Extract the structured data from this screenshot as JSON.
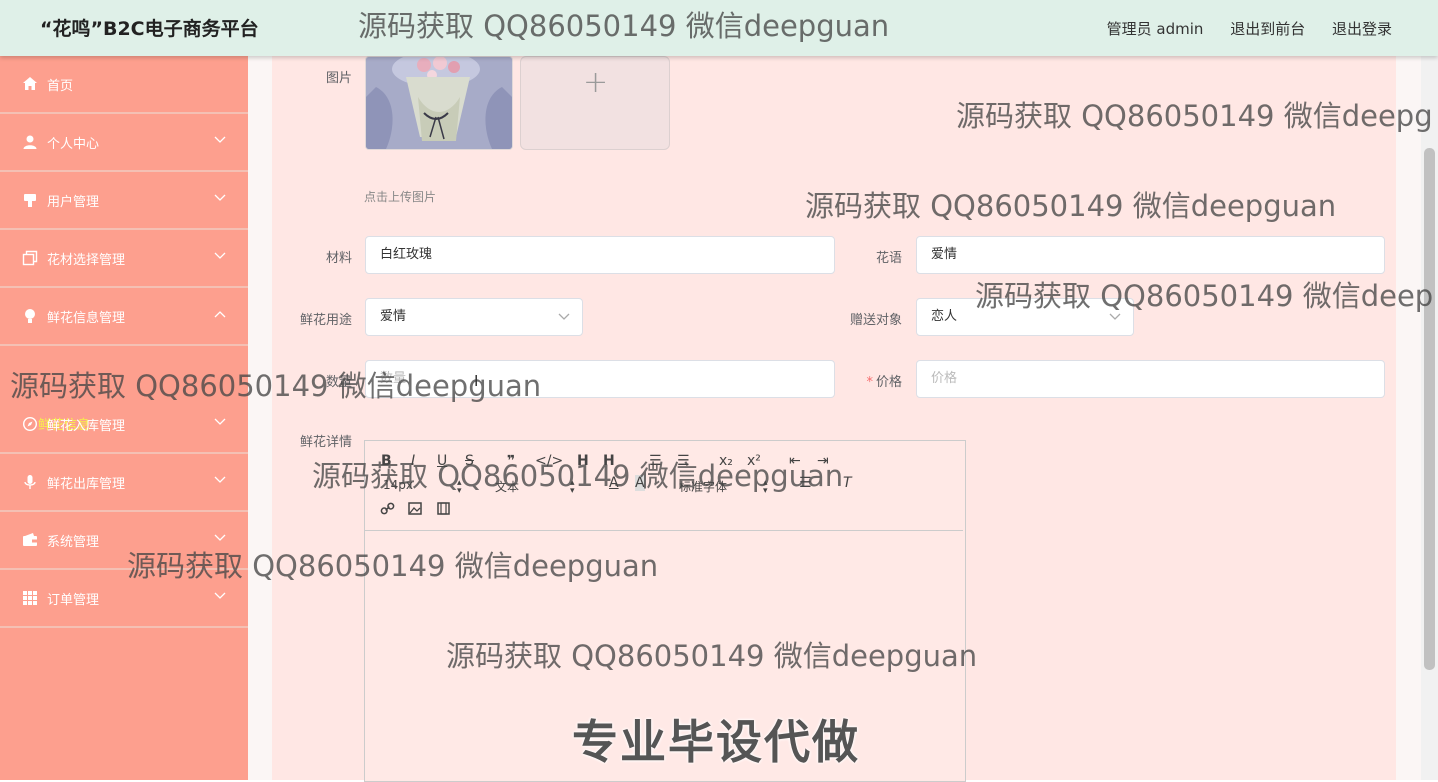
{
  "header": {
    "title": "“花鸣”B2C电子商务平台",
    "admin": "管理员 admin",
    "to_front": "退出到前台",
    "logout": "退出登录"
  },
  "sidebar": {
    "items": [
      {
        "label": "首页",
        "icon": "home-icon"
      },
      {
        "label": "个人中心",
        "icon": "user-icon"
      },
      {
        "label": "用户管理",
        "icon": "users-icon"
      },
      {
        "label": "花材选择管理",
        "icon": "copy-icon"
      },
      {
        "label": "鲜花信息管理",
        "icon": "bulb-icon"
      },
      {
        "label": "鲜花入库管理",
        "icon": "compass-icon"
      },
      {
        "label": "鲜花出库管理",
        "icon": "mic-icon"
      },
      {
        "label": "系统管理",
        "icon": "wallet-icon"
      },
      {
        "label": "订单管理",
        "icon": "grid-icon"
      }
    ],
    "submenu_label": "鲜花信息"
  },
  "form": {
    "image_label": "图片",
    "upload_hint": "点击上传图片",
    "material_label": "材料",
    "material_value": "白红玫瑰",
    "language_label": "花语",
    "language_value": "爱情",
    "usage_label": "鲜花用途",
    "usage_value": "爱情",
    "recipient_label": "赠送对象",
    "recipient_value": "恋人",
    "quantity_label": "数量",
    "quantity_placeholder": "数量",
    "price_required": "*",
    "price_label": "价格",
    "price_placeholder": "价格",
    "details_label": "鲜花详情"
  },
  "editor": {
    "font_size": "14px",
    "text_style": "文本",
    "font_family": "标准字体"
  },
  "watermarks": [
    "源码获取 QQ86050149 微信deepguan",
    "源码获取 QQ86050149 微信deepg",
    "源码获取 QQ86050149 微信deepguan",
    "源码获取 QQ86050149 微信deep",
    "源码获取 QQ86050149 微信deepguan",
    "源码获取 QQ86050149 微信deepguan",
    "源码获取 QQ86050149 微信deepguan",
    "源码获取 QQ86050149 微信deepguan"
  ],
  "overlay_text": "专业毕设代做",
  "colors": {
    "header_bg": "#dff0e8",
    "sidebar_bg": "#fd9f8e",
    "card_bg": "#ffe7e4",
    "submenu_highlight": "#f6f04a",
    "required": "#f56c6c"
  }
}
